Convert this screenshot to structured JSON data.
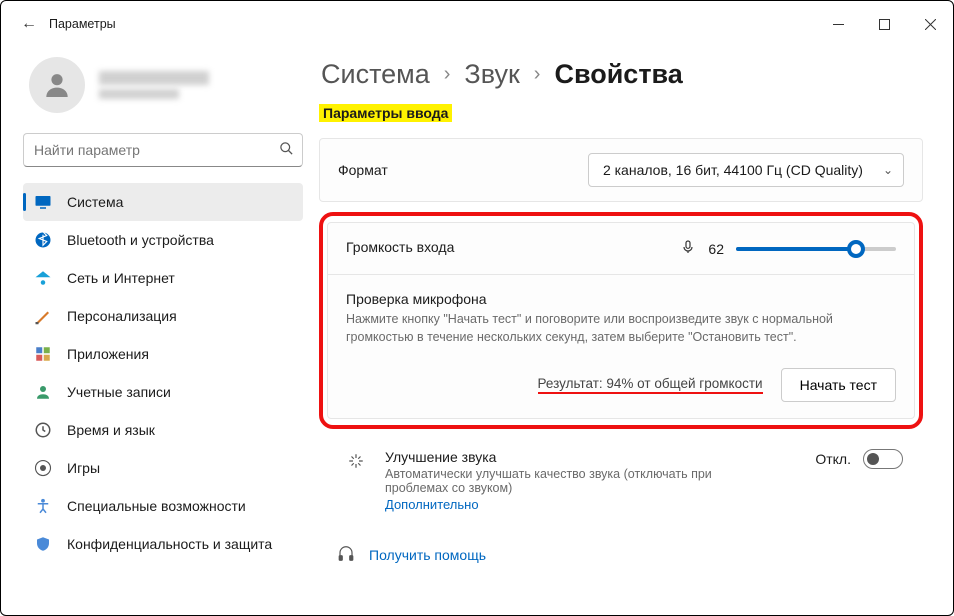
{
  "window": {
    "title": "Параметры"
  },
  "search": {
    "placeholder": "Найти параметр"
  },
  "sidebar": {
    "items": [
      {
        "label": "Система"
      },
      {
        "label": "Bluetooth и устройства"
      },
      {
        "label": "Сеть и Интернет"
      },
      {
        "label": "Персонализация"
      },
      {
        "label": "Приложения"
      },
      {
        "label": "Учетные записи"
      },
      {
        "label": "Время и язык"
      },
      {
        "label": "Игры"
      },
      {
        "label": "Специальные возможности"
      },
      {
        "label": "Конфиденциальность и защита"
      }
    ]
  },
  "breadcrumb": {
    "a": "Система",
    "b": "Звук",
    "c": "Свойства",
    "sep": "›"
  },
  "section_title": "Параметры ввода",
  "format": {
    "label": "Формат",
    "value": "2 каналов, 16 бит, 44100 Гц (CD Quality)"
  },
  "volume": {
    "label": "Громкость входа",
    "value": "62",
    "percent": 62
  },
  "mic_test": {
    "label": "Проверка микрофона",
    "desc": "Нажмите кнопку \"Начать тест\" и поговорите или воспроизведите звук с нормальной громкостью в течение нескольких секунд, затем выберите \"Остановить тест\".",
    "result": "Результат: 94% от общей громкости",
    "button": "Начать тест"
  },
  "enhance": {
    "title": "Улучшение звука",
    "desc": "Автоматически улучшать качество звука (отключать при проблемах со звуком)",
    "link": "Дополнительно",
    "state": "Откл."
  },
  "help": {
    "label": "Получить помощь"
  }
}
